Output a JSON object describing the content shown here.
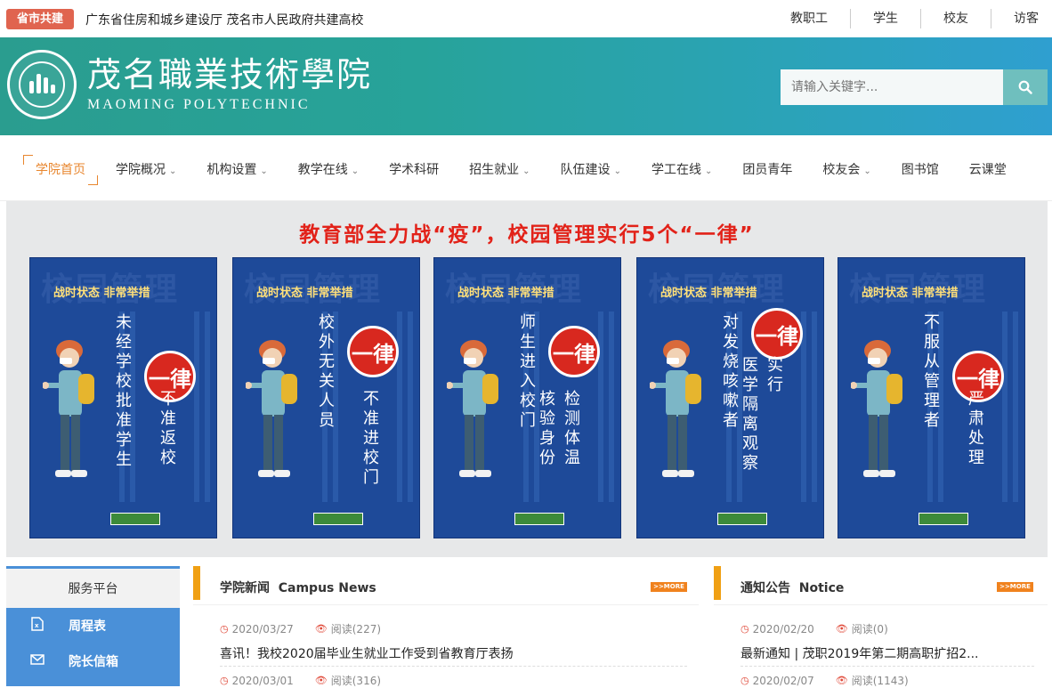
{
  "topbar": {
    "badge": "省市共建",
    "slogan": "广东省住房和城乡建设厅 茂名市人民政府共建高校",
    "links": [
      "教职工",
      "学生",
      "校友",
      "访客"
    ]
  },
  "header": {
    "name_cn": "茂名職業技術學院",
    "name_en": "MAOMING POLYTECHNIC",
    "search_placeholder": "请输入关键字..."
  },
  "nav": {
    "items": [
      {
        "label": "学院首页",
        "active": true
      },
      {
        "label": "学院概况",
        "caret": true
      },
      {
        "label": "机构设置",
        "caret": true
      },
      {
        "label": "教学在线",
        "caret": true
      },
      {
        "label": "学术科研"
      },
      {
        "label": "招生就业",
        "caret": true
      },
      {
        "label": "队伍建设",
        "caret": true
      },
      {
        "label": "学工在线",
        "caret": true
      },
      {
        "label": "团员青年"
      },
      {
        "label": "校友会",
        "caret": true
      },
      {
        "label": "图书馆"
      },
      {
        "label": "云课堂"
      }
    ]
  },
  "banner": {
    "headline": "教育部全力战“疫”，校园管理实行5个“一律”",
    "poster_watermark": "校园管理",
    "poster_tag": "战时状态 非常举措",
    "seal": "一律",
    "posters": [
      {
        "left": "未经学校批准学生",
        "right": "不准返校"
      },
      {
        "left": "校外无关人员",
        "right": "不准进校门"
      },
      {
        "left": "师生进入校门",
        "right": "检测体温 核验身份"
      },
      {
        "left": "对发烧咳嗽者",
        "right": "实行 医学隔离观察"
      },
      {
        "left": "不服从管理者",
        "right": "严肃处理"
      }
    ]
  },
  "services": {
    "title": "服务平台",
    "items": [
      "周程表",
      "院长信箱"
    ]
  },
  "news": {
    "title": "学院新闻",
    "title_en": "Campus News",
    "more": ">>MORE",
    "items": [
      {
        "date": "2020/03/27",
        "views": "阅读(227)",
        "title": "喜讯！我校2020届毕业生就业工作受到省教育厅表扬"
      },
      {
        "date": "2020/03/01",
        "views": "阅读(316)"
      }
    ]
  },
  "notice": {
    "title": "通知公告",
    "title_en": "Notice",
    "more": ">>MORE",
    "items": [
      {
        "date": "2020/02/20",
        "views": "阅读(0)",
        "title": "最新通知 | 茂职2019年第二期高职扩招2..."
      },
      {
        "date": "2020/02/07",
        "views": "阅读(1143)"
      }
    ]
  },
  "colors": {
    "accent": "#e8862e",
    "badge": "#e0644f",
    "headline": "#e22219",
    "poster_bg": "#1e4a99",
    "service_blue": "#4a90d8",
    "panel_bar": "#f0a014"
  }
}
